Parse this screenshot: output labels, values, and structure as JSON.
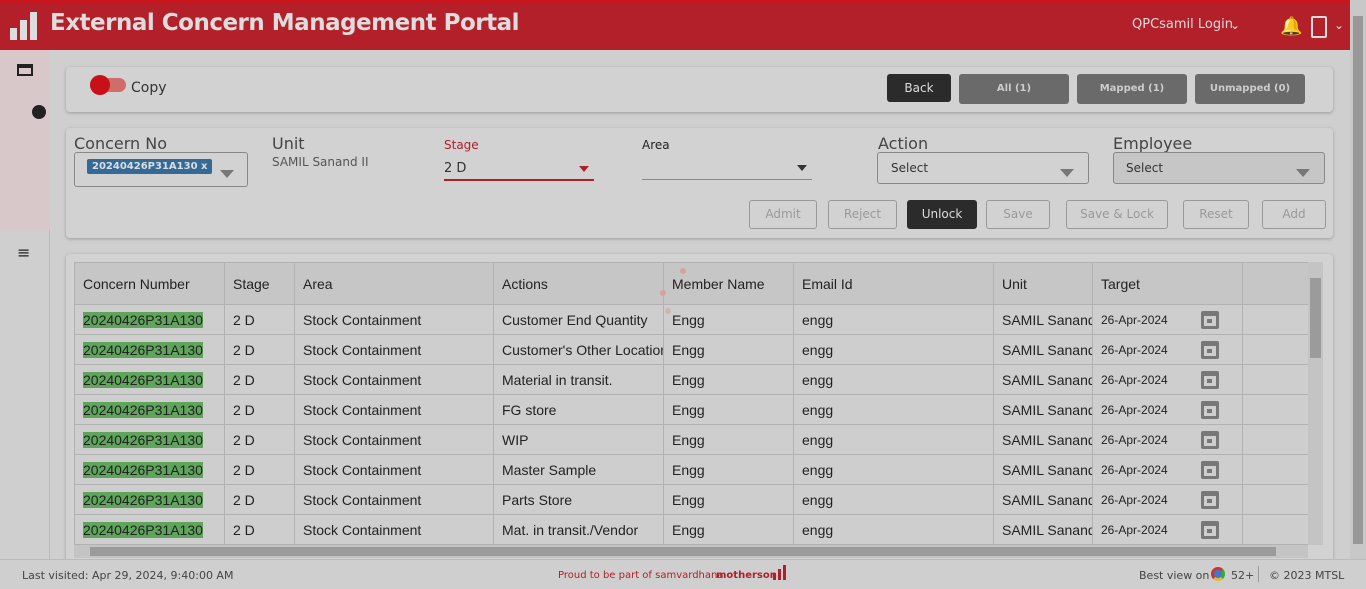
{
  "header": {
    "title": "External Concern Management Portal",
    "user": "QPCsamil Login"
  },
  "toolbar": {
    "copy_label": "Copy",
    "copy_on": true,
    "back": "Back",
    "all": "All (1)",
    "mapped": "Mapped (1)",
    "unmapped": "Unmapped (0)"
  },
  "filters": {
    "concern_no_label": "Concern No",
    "concern_chip": "20240426P31A130 x",
    "unit_label": "Unit",
    "unit_value": "SAMIL Sanand II",
    "stage_label": "Stage",
    "stage_value": "2 D",
    "area_label": "Area",
    "area_value": "",
    "action_label": "Action",
    "action_value": "Select",
    "employee_label": "Employee",
    "employee_value": "Select"
  },
  "actions": {
    "admit": "Admit",
    "reject": "Reject",
    "unlock": "Unlock",
    "save": "Save",
    "save_lock": "Save & Lock",
    "reset": "Reset",
    "add": "Add"
  },
  "table": {
    "columns": [
      "Concern Number",
      "Stage",
      "Area",
      "Actions",
      "Member Name",
      "Email Id",
      "Unit",
      "Target",
      ""
    ],
    "rows": [
      [
        "20240426P31A130",
        "2 D",
        "Stock Containment",
        "Customer End Quantity",
        "Engg",
        "engg",
        "SAMIL Sanand II",
        "26-Apr-2024"
      ],
      [
        "20240426P31A130",
        "2 D",
        "Stock Containment",
        "Customer's Other Location",
        "Engg",
        "engg",
        "SAMIL Sanand II",
        "26-Apr-2024"
      ],
      [
        "20240426P31A130",
        "2 D",
        "Stock Containment",
        "Material in transit.",
        "Engg",
        "engg",
        "SAMIL Sanand II",
        "26-Apr-2024"
      ],
      [
        "20240426P31A130",
        "2 D",
        "Stock Containment",
        "FG store",
        "Engg",
        "engg",
        "SAMIL Sanand II",
        "26-Apr-2024"
      ],
      [
        "20240426P31A130",
        "2 D",
        "Stock Containment",
        "WIP",
        "Engg",
        "engg",
        "SAMIL Sanand II",
        "26-Apr-2024"
      ],
      [
        "20240426P31A130",
        "2 D",
        "Stock Containment",
        "Master Sample",
        "Engg",
        "engg",
        "SAMIL Sanand II",
        "26-Apr-2024"
      ],
      [
        "20240426P31A130",
        "2 D",
        "Stock Containment",
        "Parts Store",
        "Engg",
        "engg",
        "SAMIL Sanand II",
        "26-Apr-2024"
      ],
      [
        "20240426P31A130",
        "2 D",
        "Stock Containment",
        "Mat. in transit./Vendor",
        "Engg",
        "engg",
        "SAMIL Sanand II",
        "26-Apr-2024"
      ]
    ]
  },
  "footer": {
    "last_visited": "Last visited: Apr 29, 2024, 9:40:00 AM",
    "proud": "Proud to be part of samvardhana",
    "brand": "motherson",
    "best_view": "Best view on",
    "version": "52+",
    "copyright": "© 2023 MTSL"
  }
}
